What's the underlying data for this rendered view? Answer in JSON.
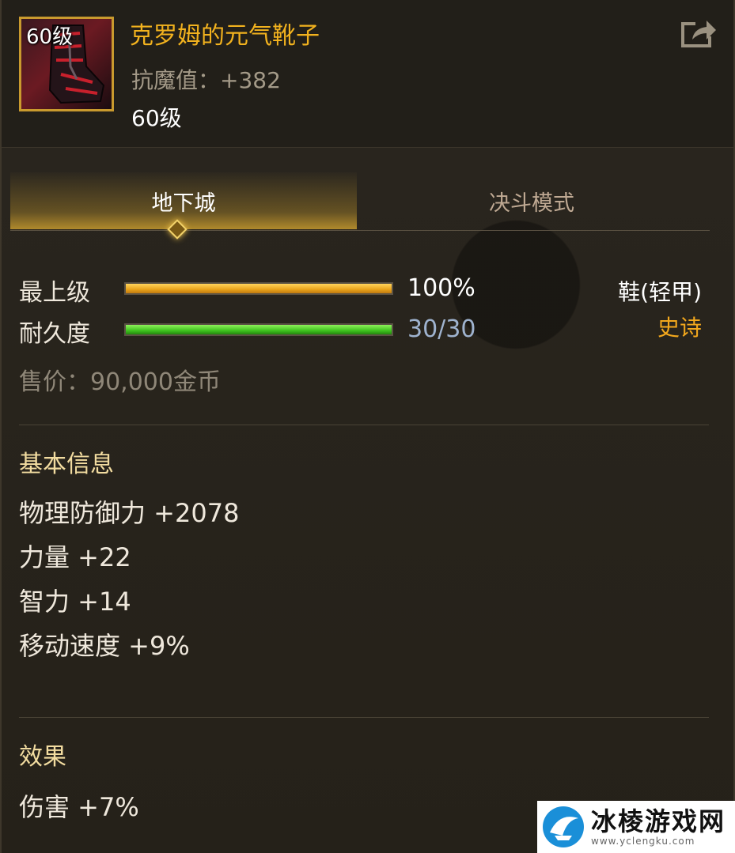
{
  "item": {
    "icon_level": "60级",
    "name": "克罗姆的元气靴子",
    "stat": "抗魔值：+382",
    "level": "60级"
  },
  "tabs": [
    {
      "label": "地下城",
      "active": true
    },
    {
      "label": "决斗模式",
      "active": false
    }
  ],
  "bars": {
    "grade": {
      "label": "最上级",
      "value_text": "100%",
      "fill": 1.0,
      "value_color": "#ffffff"
    },
    "durability": {
      "label": "耐久度",
      "value_text": "30/30",
      "fill": 1.0,
      "value_color": "#9fb3cf"
    }
  },
  "type": "鞋(轻甲)",
  "rarity": "史诗",
  "price": "售价：90,000金币",
  "basic": {
    "title": "基本信息",
    "stats": [
      "物理防御力 +2078",
      "力量 +22",
      "智力 +14",
      "移动速度 +9%"
    ]
  },
  "effect": {
    "title": "效果",
    "stats": [
      "伤害 +7%"
    ]
  },
  "watermark": {
    "title": "冰棱游戏网",
    "url": "www.yclengku.com"
  },
  "colors": {
    "name": "#f2b21e",
    "rarity_epic": "#f3a81d",
    "frame": "#c99a2e"
  },
  "icons": [
    "share-icon",
    "boots-icon",
    "tab-diamond-icon",
    "watermark-logo-icon"
  ]
}
